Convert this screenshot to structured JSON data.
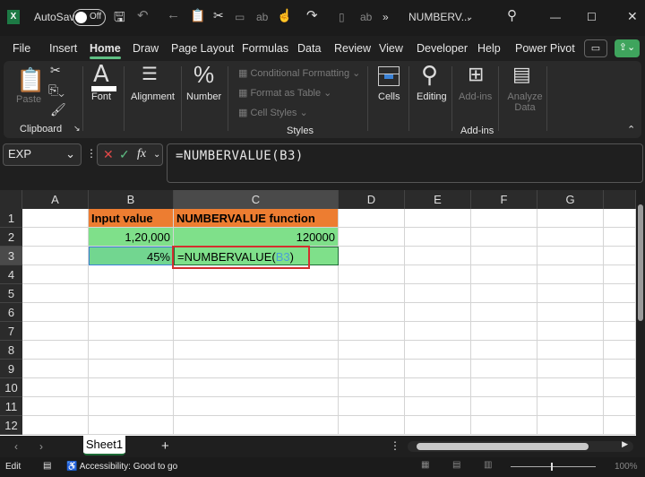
{
  "title_bar": {
    "autosave_label": "AutoSave",
    "autosave_state": "Off",
    "file_name": "NUMBERV...",
    "overflow": "»"
  },
  "menu_tabs": [
    "File",
    "Insert",
    "Home",
    "Draw",
    "Page Layout",
    "Formulas",
    "Data",
    "Review",
    "View",
    "Developer",
    "Help",
    "Power Pivot"
  ],
  "ribbon": {
    "paste": "Paste",
    "clipboard": "Clipboard",
    "font": "Font",
    "alignment": "Alignment",
    "number": "Number",
    "conditional_formatting": "Conditional Formatting",
    "format_as_table": "Format as Table",
    "cell_styles": "Cell Styles",
    "styles": "Styles",
    "cells": "Cells",
    "editing": "Editing",
    "addins": "Add-ins",
    "addins_group": "Add-ins",
    "analyze_data": "Analyze Data"
  },
  "formula_bar": {
    "name_box": "EXP",
    "fx": "fx",
    "formula": "=NUMBERVALUE(B3)"
  },
  "columns": [
    "A",
    "B",
    "C",
    "D",
    "E",
    "F",
    "G"
  ],
  "rows": [
    "1",
    "2",
    "3",
    "4",
    "5",
    "6",
    "7",
    "8",
    "9",
    "10",
    "11",
    "12"
  ],
  "cells": {
    "B1": "Input value",
    "C1": "NUMBERVALUE function",
    "B2": "1,20,000",
    "C2": "120000",
    "B3": "45%",
    "C3_prefix": "=NUMBERVALUE(",
    "C3_ref": "B3",
    "C3_suffix": ")"
  },
  "colors": {
    "header_orange": "#ed7d31",
    "cell_green": "#7fe08a",
    "highlight_red": "#d32f2f",
    "ref_blue": "#4a9fd8"
  },
  "sheets": [
    "Sheet1"
  ],
  "status": {
    "mode": "Edit",
    "accessibility": "Accessibility: Good to go",
    "zoom": "100%"
  }
}
